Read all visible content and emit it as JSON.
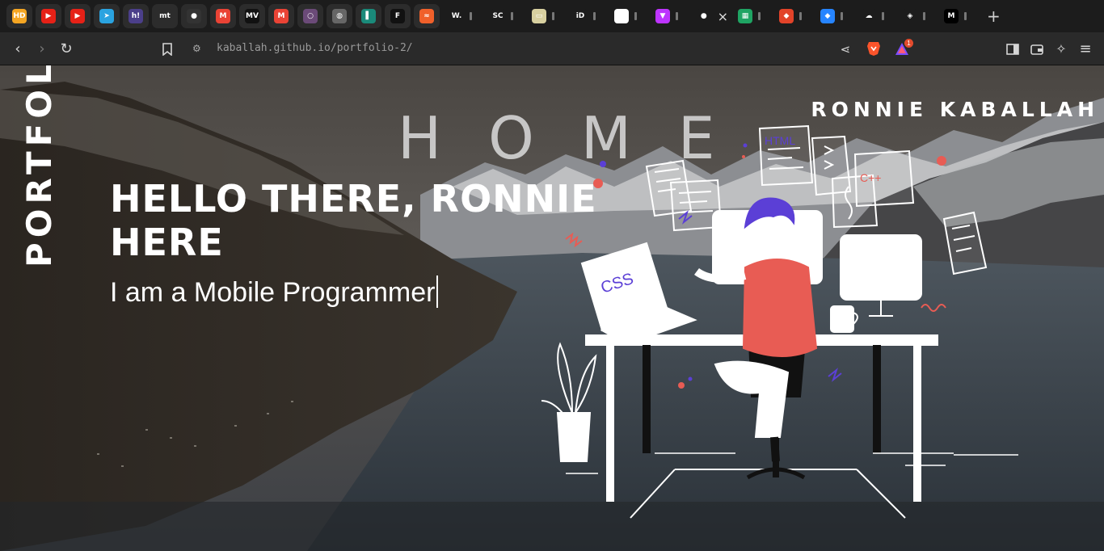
{
  "tabs": [
    {
      "icon": "hd-icon",
      "glyph": "HD",
      "color": "#f5a623"
    },
    {
      "icon": "youtube-icon",
      "glyph": "▶",
      "color": "#e62117"
    },
    {
      "icon": "youtube-icon",
      "glyph": "▶",
      "color": "#e62117"
    },
    {
      "icon": "telegram-icon",
      "glyph": "➤",
      "color": "#2aa3e0"
    },
    {
      "icon": "hackerrank-icon",
      "glyph": "h!",
      "color": "#4b3f8a"
    },
    {
      "icon": "mt-icon",
      "glyph": "mt",
      "color": "#2c2c2c"
    },
    {
      "icon": "github-icon",
      "glyph": "●",
      "color": "#333333"
    },
    {
      "icon": "gmail-icon",
      "glyph": "M",
      "color": "#ea4335"
    },
    {
      "icon": "movie-icon",
      "glyph": "MV",
      "color": "#111111"
    },
    {
      "icon": "gmail-icon",
      "glyph": "M",
      "color": "#ea4335"
    },
    {
      "icon": "circle-icon",
      "glyph": "○",
      "color": "#6b4a78"
    },
    {
      "icon": "globe-icon",
      "glyph": "◍",
      "color": "#666666"
    },
    {
      "icon": "bookmark-icon",
      "glyph": "▌",
      "color": "#1a8a7a"
    },
    {
      "icon": "framer-icon",
      "glyph": "F",
      "color": "#111111"
    },
    {
      "icon": "chart-icon",
      "glyph": "≈",
      "color": "#f0602a"
    }
  ],
  "wide_tabs": [
    {
      "icon": "w-icon",
      "glyph": "W.",
      "color": "#1c1c1c"
    },
    {
      "icon": "sc-icon",
      "glyph": "SC",
      "color": "#1c1c1c"
    },
    {
      "icon": "image-icon",
      "glyph": "▭",
      "color": "#d8d0a0"
    },
    {
      "icon": "id-icon",
      "glyph": "iD",
      "color": "#1c1c1c"
    },
    {
      "icon": "google-icon",
      "glyph": "G",
      "color": "#ffffff"
    },
    {
      "icon": "vite-icon",
      "glyph": "▼",
      "color": "#bd34fe"
    },
    {
      "icon": "github-icon",
      "glyph": "●",
      "color": "#1c1c1c"
    },
    {
      "icon": "sheets-icon",
      "glyph": "▦",
      "color": "#1fa463"
    },
    {
      "icon": "gitlab-icon",
      "glyph": "◆",
      "color": "#e24329"
    },
    {
      "icon": "jira-icon",
      "glyph": "◆",
      "color": "#2684ff"
    },
    {
      "icon": "cloud-icon",
      "glyph": "☁",
      "color": "#1c1c1c"
    },
    {
      "icon": "brave-icon",
      "glyph": "◈",
      "color": "#1c1c1c"
    },
    {
      "icon": "medium-icon",
      "glyph": "M",
      "color": "#000000"
    }
  ],
  "toolbar": {
    "url": "kaballah.github.io/portfolio-2/",
    "rewards_count": "1"
  },
  "page": {
    "side_title": "PORTFOLIO",
    "brand": "RONNIE KABALLAH",
    "section_title": "HOME",
    "greeting": "HELLO THERE, RONNIE HERE",
    "subtitle": "I am a Mobile Programmer"
  },
  "illustration": {
    "laptop_label": "CSS",
    "file_label": "HTML",
    "cpp_label": "C++",
    "accent": "#e85c54",
    "purple": "#5b3fd6"
  }
}
